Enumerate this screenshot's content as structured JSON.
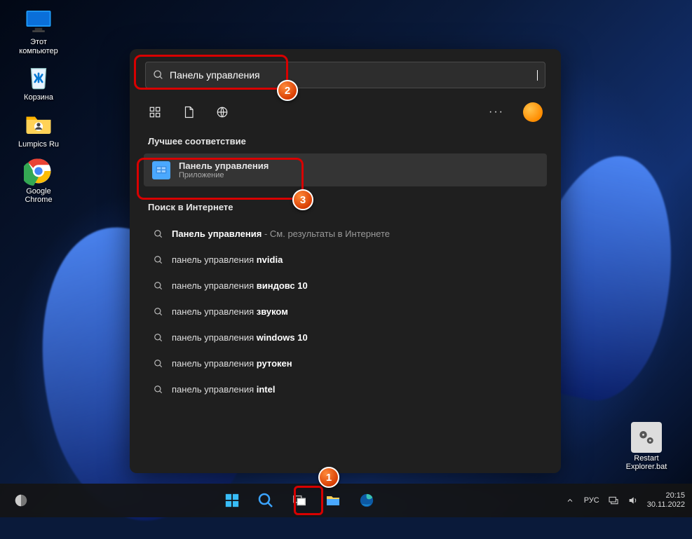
{
  "desktop": {
    "icons": [
      {
        "name": "this-pc",
        "label": "Этот\nкомпьютер"
      },
      {
        "name": "recycle-bin",
        "label": "Корзина"
      },
      {
        "name": "lumpics",
        "label": "Lumpics Ru"
      },
      {
        "name": "chrome",
        "label": "Google\nChrome"
      }
    ],
    "right_icon": {
      "name": "restart-explorer",
      "label": "Restart\nExplorer.bat"
    }
  },
  "search": {
    "query": "Панель управления",
    "best_match_heading": "Лучшее соответствие",
    "best_match": {
      "title": "Панель управления",
      "subtitle": "Приложение"
    },
    "web_heading": "Поиск в Интернете",
    "web_suffix": " - См. результаты в Интернете",
    "web_first_prefix": "Панель управления",
    "web_results": [
      {
        "prefix": "панель управления ",
        "bold": "nvidia"
      },
      {
        "prefix": "панель управления ",
        "bold": "виндовс 10"
      },
      {
        "prefix": "панель управления ",
        "bold": "звуком"
      },
      {
        "prefix": "панель управления ",
        "bold": "windows 10"
      },
      {
        "prefix": "панель управления ",
        "bold": "рутокен"
      },
      {
        "prefix": "панель управления ",
        "bold": "intel"
      }
    ]
  },
  "taskbar": {
    "lang": "РУС",
    "time": "20:15",
    "date": "30.11.2022"
  },
  "annotations": {
    "step1": "1",
    "step2": "2",
    "step3": "3"
  }
}
